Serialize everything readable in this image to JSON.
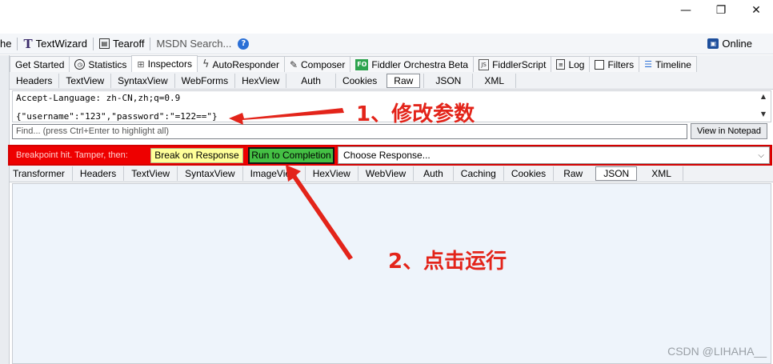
{
  "window": {
    "minimize_glyph": "—",
    "restore_glyph": "❐",
    "close_glyph": "✕"
  },
  "toolbar": {
    "cache_partial": "he",
    "textwizard_label": "TextWizard",
    "tearoff_label": "Tearoff",
    "msdn_placeholder": "MSDN Search...",
    "online_label": "Online"
  },
  "main_tabs": [
    {
      "label": "Get Started",
      "icon": "none"
    },
    {
      "label": "Statistics",
      "icon": "stopwatch-icon"
    },
    {
      "label": "Inspectors",
      "icon": "inspect-icon"
    },
    {
      "label": "AutoResponder",
      "icon": "lightning-icon"
    },
    {
      "label": "Composer",
      "icon": "compose-icon"
    },
    {
      "label": "Fiddler Orchestra Beta",
      "icon": "fo-icon"
    },
    {
      "label": "FiddlerScript",
      "icon": "script-icon"
    },
    {
      "label": "Log",
      "icon": "log-icon"
    },
    {
      "label": "Filters",
      "icon": "checkbox-icon"
    },
    {
      "label": "Timeline",
      "icon": "timeline-icon"
    }
  ],
  "request_tabs": [
    "Headers",
    "TextView",
    "SyntaxView",
    "WebForms",
    "HexView",
    "Auth",
    "Cookies",
    "Raw",
    "JSON",
    "XML"
  ],
  "request_active_tab": "Raw",
  "raw_text": {
    "line1": "Accept-Language: zh-CN,zh;q=0.9",
    "line2": "{\"username\":\"123\",\"password\":\"=122==\"}"
  },
  "find": {
    "placeholder": "Find... (press Ctrl+Enter to highlight all)",
    "view_in_notepad": "View in Notepad"
  },
  "breakpoint": {
    "label": "Breakpoint hit. Tamper, then:",
    "break_on_response": "Break on Response",
    "run_to_completion": "Run to Completion",
    "choose_response": "Choose Response..."
  },
  "response_tabs": [
    "Transformer",
    "Headers",
    "TextView",
    "SyntaxView",
    "ImageView",
    "HexView",
    "WebView",
    "Auth",
    "Caching",
    "Cookies",
    "Raw",
    "JSON",
    "XML"
  ],
  "response_active_tab": "JSON",
  "annotations": {
    "step1": "1、修改参数",
    "step2": "2、点击运行",
    "color": "#e3241a"
  },
  "watermark": "CSDN @LIHAHA__"
}
